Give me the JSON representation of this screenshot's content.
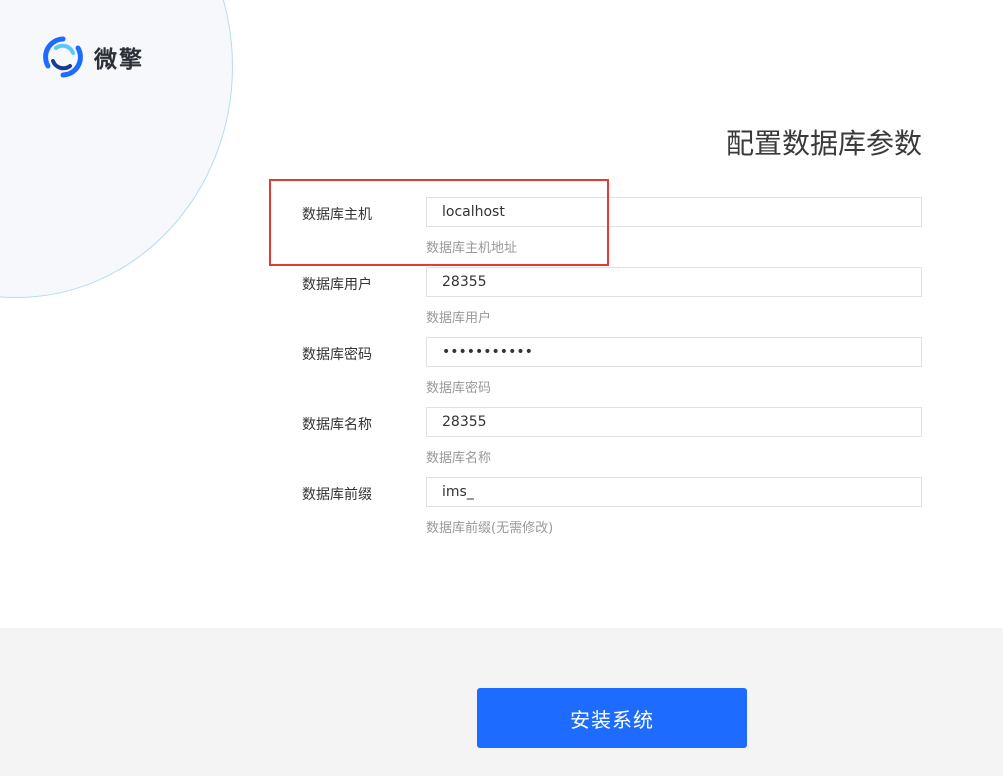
{
  "brand": {
    "name": "微擎",
    "logo_icon": "swirl-logo-icon",
    "logo_colors": [
      "#1e6cff",
      "#5ac8fa",
      "#1a3a8f"
    ]
  },
  "title": "配置数据库参数",
  "fields": [
    {
      "label": "数据库主机",
      "value": "localhost",
      "type": "text",
      "hint": "数据库主机地址"
    },
    {
      "label": "数据库用户",
      "value": "28355",
      "type": "text",
      "hint": "数据库用户"
    },
    {
      "label": "数据库密码",
      "value": "•••••••••••",
      "type": "password",
      "hint": "数据库密码"
    },
    {
      "label": "数据库名称",
      "value": "28355",
      "type": "text",
      "hint": "数据库名称"
    },
    {
      "label": "数据库前缀",
      "value": "ims_",
      "type": "text",
      "hint": "数据库前缀(无需修改)"
    }
  ],
  "highlight": {
    "target": "数据库主机",
    "color": "#e53935"
  },
  "footer": {
    "install_label": "安装系统",
    "button_color": "#1e6cff"
  }
}
